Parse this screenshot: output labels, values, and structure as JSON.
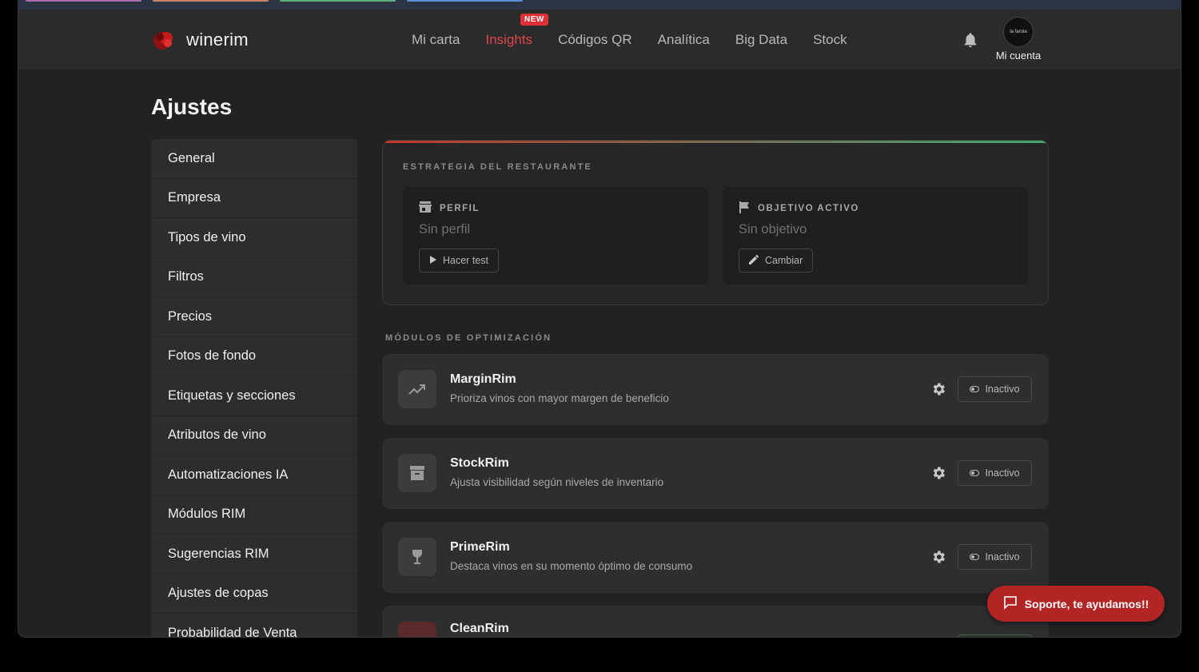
{
  "brand": {
    "name": "winerim"
  },
  "nav": {
    "items": [
      {
        "label": "Mi carta",
        "active": false
      },
      {
        "label": "Insights",
        "active": true
      },
      {
        "label": "Códigos QR",
        "active": false
      },
      {
        "label": "Analítica",
        "active": false
      },
      {
        "label": "Big Data",
        "active": false
      },
      {
        "label": "Stock",
        "active": false
      }
    ],
    "new_badge": "NEW",
    "account_label": "Mi cuenta",
    "avatar_text": "la farola"
  },
  "page": {
    "title": "Ajustes"
  },
  "sidebar": {
    "items": [
      {
        "label": "General"
      },
      {
        "label": "Empresa"
      },
      {
        "label": "Tipos de vino"
      },
      {
        "label": "Filtros"
      },
      {
        "label": "Precios"
      },
      {
        "label": "Fotos de fondo"
      },
      {
        "label": "Etiquetas y secciones"
      },
      {
        "label": "Atributos de vino"
      },
      {
        "label": "Automatizaciones IA"
      },
      {
        "label": "Módulos RIM"
      },
      {
        "label": "Sugerencias RIM"
      },
      {
        "label": "Ajustes de copas"
      },
      {
        "label": "Probabilidad de Venta"
      }
    ]
  },
  "strategy": {
    "label": "ESTRATEGIA DEL RESTAURANTE",
    "profile": {
      "title": "PERFIL",
      "value": "Sin perfil",
      "button": "Hacer test"
    },
    "objective": {
      "title": "OBJETIVO ACTIVO",
      "value": "Sin objetivo",
      "button": "Cambiar"
    }
  },
  "modules": {
    "label": "MÓDULOS DE OPTIMIZACIÓN",
    "items": [
      {
        "name": "MarginRim",
        "description": "Prioriza vinos con mayor margen de beneficio",
        "status": "Inactivo",
        "icon": "trending-up-icon"
      },
      {
        "name": "StockRim",
        "description": "Ajusta visibilidad según niveles de inventario",
        "status": "Inactivo",
        "icon": "archive-box-icon"
      },
      {
        "name": "PrimeRim",
        "description": "Destaca vinos en su momento óptimo de consumo",
        "status": "Inactivo",
        "icon": "wine-glass-icon"
      },
      {
        "name": "CleanRim",
        "description": "",
        "status": "",
        "icon": "clean-icon"
      }
    ]
  },
  "support": {
    "label": "Soporte, te ayudamos!!"
  },
  "colors": {
    "accent": "#e0474c",
    "support": "#b32424",
    "background": "#222222"
  }
}
